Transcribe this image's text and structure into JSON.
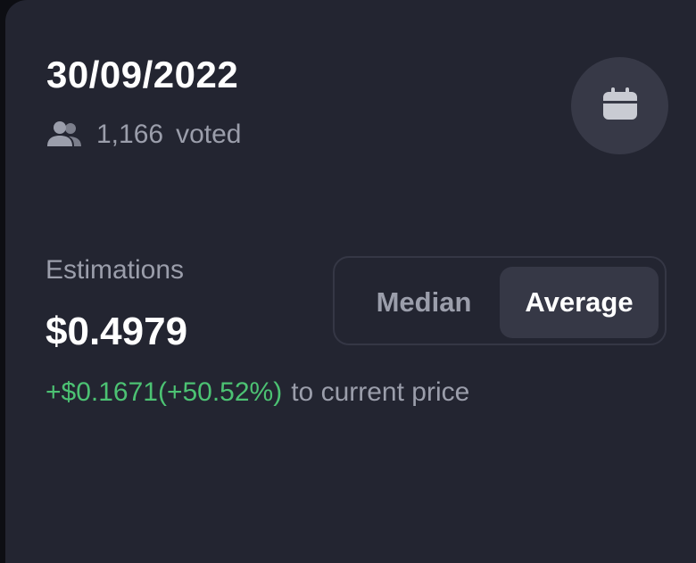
{
  "header": {
    "date": "30/09/2022",
    "votes_count": "1,166",
    "votes_label": "voted",
    "calendar_icon": "calendar-icon",
    "users_icon": "users-icon"
  },
  "estimation": {
    "label": "Estimations",
    "value": "$0.4979",
    "change_delta": "+$0.1671(+50.52%)",
    "change_suffix": "to current price"
  },
  "toggle": {
    "options": [
      "Median",
      "Average"
    ],
    "selected": "Average"
  },
  "colors": {
    "background": "#232531",
    "positive": "#4cc273",
    "muted_text": "#9b9eab",
    "active_segment": "#363846"
  }
}
